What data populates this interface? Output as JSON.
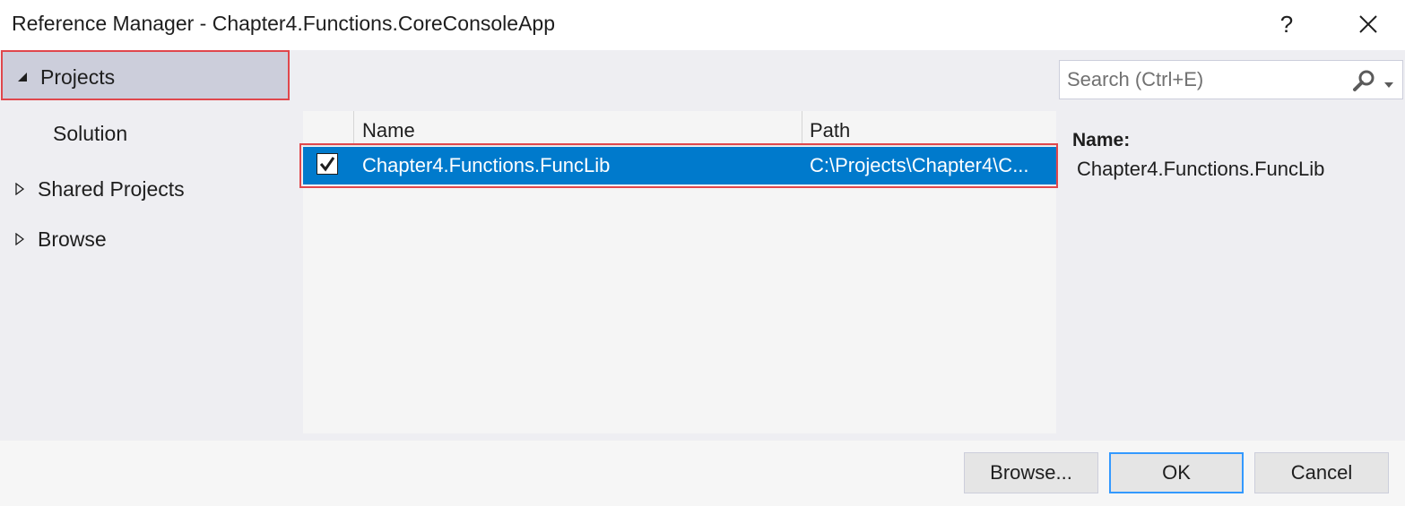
{
  "window": {
    "title": "Reference Manager - Chapter4.Functions.CoreConsoleApp",
    "help_label": "?"
  },
  "sidebar": {
    "items": [
      {
        "label": "Projects",
        "expanded": true,
        "selected": true
      },
      {
        "label": "Solution",
        "child": true
      },
      {
        "label": "Shared Projects",
        "expanded": false
      },
      {
        "label": "Browse",
        "expanded": false
      }
    ]
  },
  "search": {
    "placeholder": "Search (Ctrl+E)",
    "value": ""
  },
  "grid": {
    "columns": [
      "Name",
      "Path"
    ],
    "rows": [
      {
        "checked": true,
        "name": "Chapter4.Functions.FuncLib",
        "path": "C:\\Projects\\Chapter4\\C..."
      }
    ]
  },
  "details": {
    "label": "Name:",
    "value": "Chapter4.Functions.FuncLib"
  },
  "buttons": {
    "browse": "Browse...",
    "ok": "OK",
    "cancel": "Cancel"
  },
  "colors": {
    "selection": "#007acc",
    "highlight_outline": "#e0474c",
    "panel_bg": "#eeeef2"
  },
  "icons": {
    "expanded": "triangle-down-right-icon",
    "collapsed": "triangle-right-outline-icon",
    "search": "search-icon",
    "close": "close-icon"
  }
}
